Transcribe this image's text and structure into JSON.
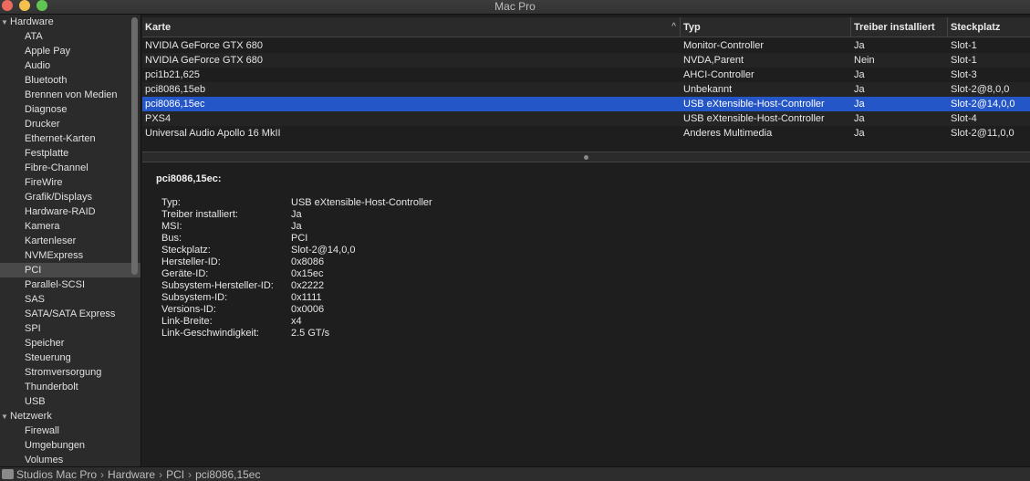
{
  "window": {
    "title": "Mac Pro"
  },
  "sidebar": {
    "groups": [
      {
        "label": "Hardware",
        "items": [
          "ATA",
          "Apple Pay",
          "Audio",
          "Bluetooth",
          "Brennen von Medien",
          "Diagnose",
          "Drucker",
          "Ethernet-Karten",
          "Festplatte",
          "Fibre-Channel",
          "FireWire",
          "Grafik/Displays",
          "Hardware-RAID",
          "Kamera",
          "Kartenleser",
          "NVMExpress",
          "PCI",
          "Parallel-SCSI",
          "SAS",
          "SATA/SATA Express",
          "SPI",
          "Speicher",
          "Steuerung",
          "Stromversorgung",
          "Thunderbolt",
          "USB"
        ]
      },
      {
        "label": "Netzwerk",
        "items": [
          "Firewall",
          "Umgebungen",
          "Volumes"
        ]
      }
    ],
    "selected": "PCI"
  },
  "table": {
    "columns": [
      "Karte",
      "Typ",
      "Treiber installiert",
      "Steckplatz"
    ],
    "sort_indicator": "^",
    "rows": [
      [
        "NVIDIA GeForce GTX 680",
        "Monitor-Controller",
        "Ja",
        "Slot-1"
      ],
      [
        "NVIDIA GeForce GTX 680",
        "NVDA,Parent",
        "Nein",
        "Slot-1"
      ],
      [
        "pci1b21,625",
        "AHCI-Controller",
        "Ja",
        "Slot-3"
      ],
      [
        "pci8086,15eb",
        "Unbekannt",
        "Ja",
        "Slot-2@8,0,0"
      ],
      [
        "pci8086,15ec",
        "USB eXtensible-Host-Controller",
        "Ja",
        "Slot-2@14,0,0"
      ],
      [
        "PXS4",
        "USB eXtensible-Host-Controller",
        "Ja",
        "Slot-4"
      ],
      [
        "Universal Audio Apollo 16 MkII",
        "Anderes Multimedia",
        "Ja",
        "Slot-2@11,0,0"
      ]
    ],
    "selected_row": 4
  },
  "detail": {
    "title": "pci8086,15ec:",
    "properties": [
      {
        "key": "Typ:",
        "value": "USB eXtensible-Host-Controller"
      },
      {
        "key": "Treiber installiert:",
        "value": "Ja"
      },
      {
        "key": "MSI:",
        "value": "Ja"
      },
      {
        "key": "Bus:",
        "value": "PCI"
      },
      {
        "key": "Steckplatz:",
        "value": "Slot-2@14,0,0"
      },
      {
        "key": "Hersteller-ID:",
        "value": "0x8086"
      },
      {
        "key": "Geräte-ID:",
        "value": "0x15ec"
      },
      {
        "key": "Subsystem-Hersteller-ID:",
        "value": "0x2222"
      },
      {
        "key": "Subsystem-ID:",
        "value": "0x1111"
      },
      {
        "key": "Versions-ID:",
        "value": "0x0006"
      },
      {
        "key": "Link-Breite:",
        "value": "x4"
      },
      {
        "key": "Link-Geschwindigkeit:",
        "value": "2.5 GT/s"
      }
    ]
  },
  "statusbar": {
    "path": [
      "Studios Mac Pro",
      "Hardware",
      "PCI",
      "pci8086,15ec"
    ],
    "separator": "›"
  }
}
